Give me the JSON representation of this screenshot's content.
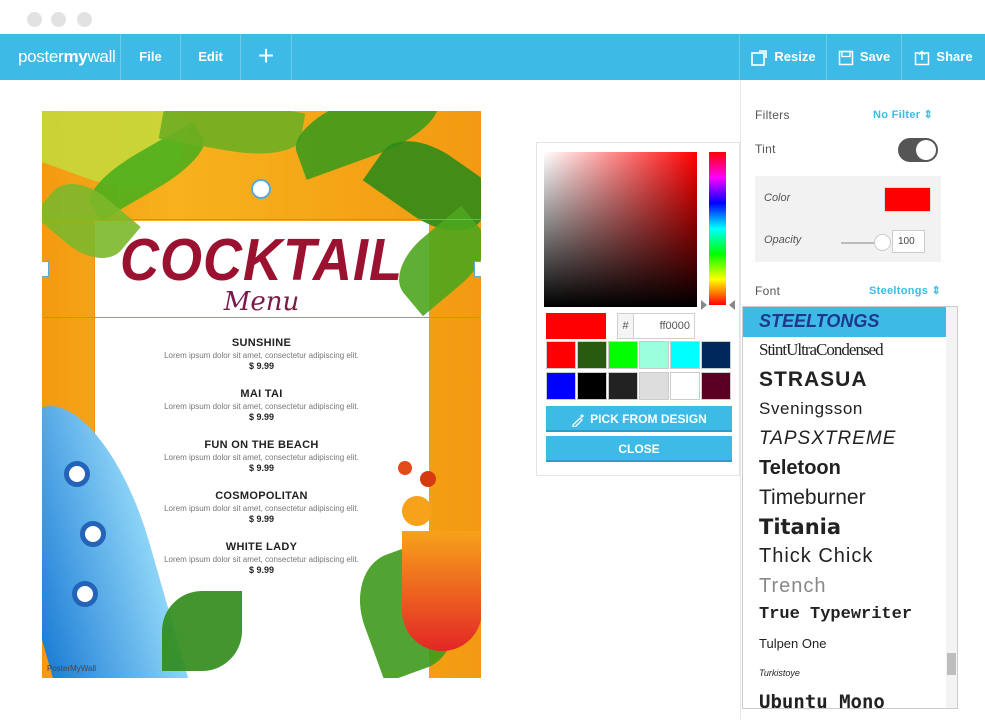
{
  "app": {
    "logo_a": "poster",
    "logo_b": "my",
    "logo_c": "wall"
  },
  "menu": {
    "file": "File",
    "edit": "Edit",
    "add": "+",
    "resize": "Resize",
    "save": "Save",
    "share": "Share"
  },
  "poster": {
    "title": "COCKTAIL",
    "subtitle": "Menu",
    "items": [
      {
        "name": "SUNSHINE",
        "desc": "Lorem ipsum dolor sit amet, consectetur adipiscing elit.",
        "price": "$ 9.99"
      },
      {
        "name": "MAI TAI",
        "desc": "Lorem ipsum dolor sit amet, consectetur adipiscing elit.",
        "price": "$ 9.99"
      },
      {
        "name": "FUN ON THE BEACH",
        "desc": "Lorem ipsum dolor sit amet, consectetur adipiscing elit.",
        "price": "$ 9.99"
      },
      {
        "name": "COSMOPOLITAN",
        "desc": "Lorem ipsum dolor sit amet, consectetur adipiscing elit.",
        "price": "$ 9.99"
      },
      {
        "name": "WHITE LADY",
        "desc": "Lorem ipsum dolor sit amet, consectetur adipiscing elit.",
        "price": "$ 9.99"
      }
    ],
    "watermark": "PosterMyWall"
  },
  "picker": {
    "hash": "#",
    "hex": "ff0000",
    "current_color": "#ff0000",
    "swatches": [
      "#ff0000",
      "#285b0f",
      "#00ff00",
      "#99ffdd",
      "#00ffff",
      "#00285b",
      "#0000ff",
      "#000000",
      "#222222",
      "#dddddd",
      "#ffffff",
      "#5b0022"
    ],
    "pick_label": "PICK FROM DESIGN",
    "close_label": "CLOSE"
  },
  "panel": {
    "filters_label": "Filters",
    "filters_value": "No Filter ⇕",
    "tint_label": "Tint",
    "tint_on": true,
    "color_label": "Color",
    "tint_color": "#ff0000",
    "opacity_label": "Opacity",
    "opacity_value": "100",
    "font_label": "Font",
    "font_value": "Steeltongs ⇕",
    "fonts": [
      "STEELTONGS",
      "StintUltraCondensed",
      "STRASUA",
      "Sveningsson",
      "TAPSXTREME",
      "Teletoon",
      "Timeburner",
      "Titania",
      "Thick Chick",
      "Trench",
      "True Typewriter",
      "Tulpen One",
      "Turkistoye",
      "Ubuntu Mono"
    ]
  },
  "accent": "#3dbbe6"
}
